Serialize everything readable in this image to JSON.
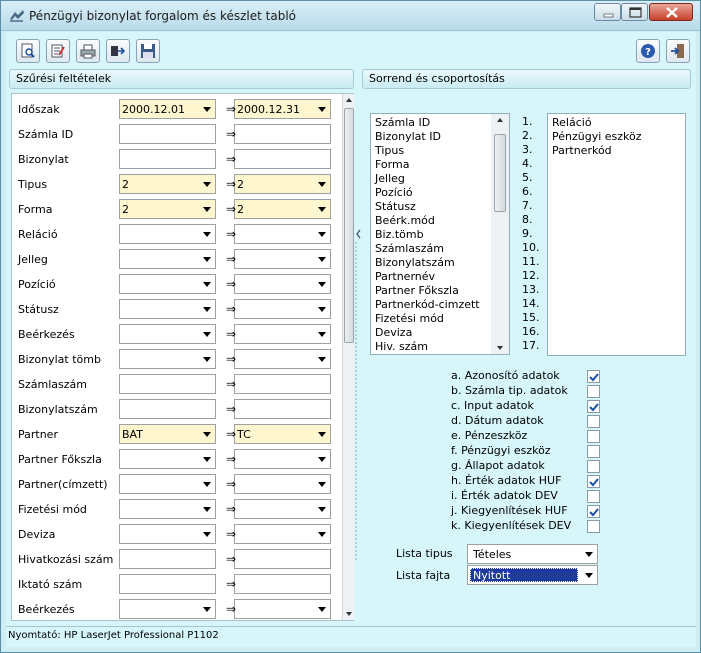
{
  "window": {
    "title": "Pénzügyi bizonylat forgalom és készlet tabló",
    "minimize_icon": "minimize-icon",
    "maximize_icon": "maximize-icon",
    "close_icon": "close-icon"
  },
  "toolbar": {
    "buttons": [
      {
        "icon": "preview-icon"
      },
      {
        "icon": "edit-list-icon"
      },
      {
        "icon": "printer-icon"
      },
      {
        "icon": "export-icon"
      },
      {
        "icon": "save-disk-icon"
      }
    ],
    "help_icon": "help-icon",
    "exit_icon": "exit-icon"
  },
  "filters": {
    "title": "Szűrési feltételek",
    "rows": [
      {
        "label": "Időszak",
        "from": "2000.12.01",
        "to": "2000.12.31",
        "combo": true,
        "highlight": true
      },
      {
        "label": "Számla ID",
        "from": "",
        "to": "",
        "combo": false,
        "highlight": false
      },
      {
        "label": "Bizonylat",
        "from": "",
        "to": "",
        "combo": false,
        "highlight": false
      },
      {
        "label": "Tipus",
        "from": "2",
        "to": "2",
        "combo": true,
        "highlight": true
      },
      {
        "label": "Forma",
        "from": "2",
        "to": "2",
        "combo": true,
        "highlight": true
      },
      {
        "label": "Reláció",
        "from": "",
        "to": "",
        "combo": true,
        "highlight": false
      },
      {
        "label": "Jelleg",
        "from": "",
        "to": "",
        "combo": true,
        "highlight": false
      },
      {
        "label": "Pozíció",
        "from": "",
        "to": "",
        "combo": true,
        "highlight": false
      },
      {
        "label": "Státusz",
        "from": "",
        "to": "",
        "combo": true,
        "highlight": false
      },
      {
        "label": "Beérkezés",
        "from": "",
        "to": "",
        "combo": true,
        "highlight": false
      },
      {
        "label": "Bizonylat tömb",
        "from": "",
        "to": "",
        "combo": true,
        "highlight": false
      },
      {
        "label": "Számlaszám",
        "from": "",
        "to": "",
        "combo": false,
        "highlight": false
      },
      {
        "label": "Bizonylatszám",
        "from": "",
        "to": "",
        "combo": false,
        "highlight": false
      },
      {
        "label": "Partner",
        "from": "BAT",
        "to": "TC",
        "combo": true,
        "highlight": true
      },
      {
        "label": "Partner Főkszla",
        "from": "",
        "to": "",
        "combo": true,
        "highlight": false
      },
      {
        "label": "Partner(címzett)",
        "from": "",
        "to": "",
        "combo": true,
        "highlight": false
      },
      {
        "label": "Fizetési mód",
        "from": "",
        "to": "",
        "combo": true,
        "highlight": false
      },
      {
        "label": "Deviza",
        "from": "",
        "to": "",
        "combo": true,
        "highlight": false
      },
      {
        "label": "Hivatkozási szám",
        "from": "",
        "to": "",
        "combo": false,
        "highlight": false
      },
      {
        "label": "Iktató szám",
        "from": "",
        "to": "",
        "combo": false,
        "highlight": false
      },
      {
        "label": "Beérkezés",
        "from": "",
        "to": "",
        "combo": true,
        "highlight": false
      }
    ],
    "arrow_symbol": "⇒"
  },
  "sorting": {
    "title": "Sorrend és csoportosítás",
    "available": [
      "Számla ID",
      "Bizonylat ID",
      "Tipus",
      "Forma",
      "Jelleg",
      "Pozíció",
      "Státusz",
      "Beérk.mód",
      "Biz.tömb",
      "Számlaszám",
      "Bizonylatszám",
      "Partnernév",
      "Partner Főkszla",
      "Partnerkód-cimzett",
      "Fizetési mód",
      "Deviza",
      "Hiv. szám"
    ],
    "numbers": [
      "1.",
      "2.",
      "3.",
      "4.",
      "5.",
      "6.",
      "7.",
      "8.",
      "9.",
      "10.",
      "11.",
      "12.",
      "13.",
      "14.",
      "15.",
      "16.",
      "17."
    ],
    "selected": [
      "Reláció",
      "Pénzügyi eszköz",
      "Partnerkód"
    ]
  },
  "options": [
    {
      "label": "a. Azonosító adatok",
      "checked": true
    },
    {
      "label": "b. Számla tip. adatok",
      "checked": false
    },
    {
      "label": "c. Input adatok",
      "checked": true
    },
    {
      "label": "d. Dátum adatok",
      "checked": false
    },
    {
      "label": "e. Pénzeszköz",
      "checked": false
    },
    {
      "label": "f. Pénzügyi eszköz",
      "checked": false
    },
    {
      "label": "g. Állapot adatok",
      "checked": false
    },
    {
      "label": "h. Érték adatok HUF",
      "checked": true
    },
    {
      "label": "i. Érték adatok DEV",
      "checked": false
    },
    {
      "label": "j. Kiegyenlítések HUF",
      "checked": true
    },
    {
      "label": "k. Kiegyenlítések DEV",
      "checked": false
    }
  ],
  "lista": {
    "tipus_label": "Lista tipus",
    "tipus_value": "Tételes",
    "fajta_label": "Lista fajta",
    "fajta_value": "Nyitott"
  },
  "status": {
    "text": "Nyomtató: HP LaserJet Professional P1102"
  },
  "colors": {
    "background": "#d6f6f9",
    "highlight_field": "#fdf6cf",
    "selected_combo": "#1e3a9a"
  }
}
